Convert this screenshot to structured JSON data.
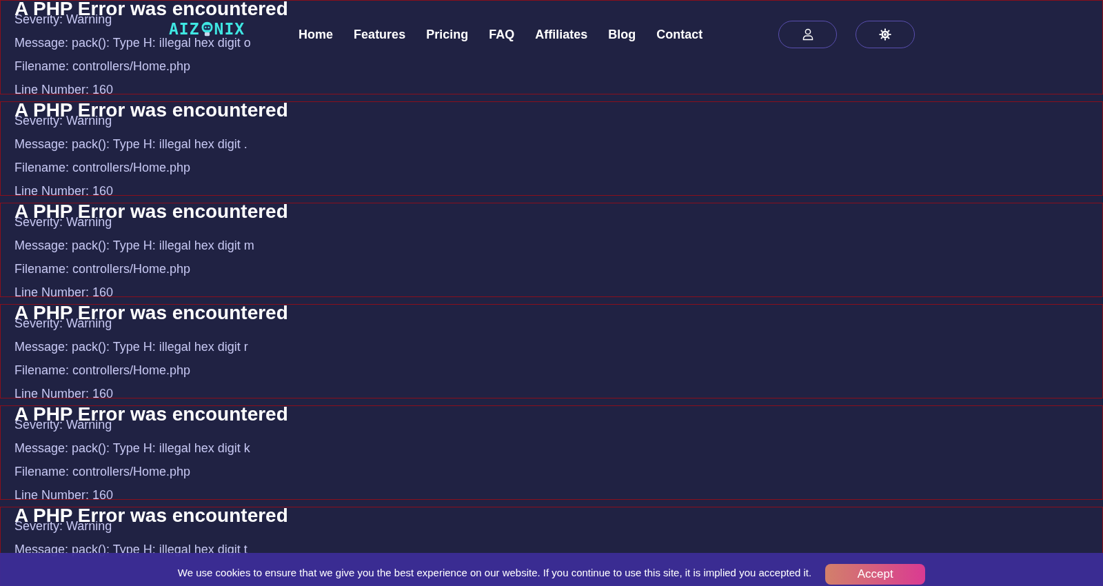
{
  "errors": [
    {
      "title": "A PHP Error was encountered",
      "lines": [
        "Severity: Warning",
        "Message: pack(): Type H: illegal hex digit o",
        "Filename: controllers/Home.php",
        "Line Number: 160"
      ]
    },
    {
      "title": "A PHP Error was encountered",
      "lines": [
        "Severity: Warning",
        "Message: pack(): Type H: illegal hex digit .",
        "Filename: controllers/Home.php",
        "Line Number: 160"
      ]
    },
    {
      "title": "A PHP Error was encountered",
      "lines": [
        "Severity: Warning",
        "Message: pack(): Type H: illegal hex digit m",
        "Filename: controllers/Home.php",
        "Line Number: 160"
      ]
    },
    {
      "title": "A PHP Error was encountered",
      "lines": [
        "Severity: Warning",
        "Message: pack(): Type H: illegal hex digit r",
        "Filename: controllers/Home.php",
        "Line Number: 160"
      ]
    },
    {
      "title": "A PHP Error was encountered",
      "lines": [
        "Severity: Warning",
        "Message: pack(): Type H: illegal hex digit k",
        "Filename: controllers/Home.php",
        "Line Number: 160"
      ]
    },
    {
      "title": "A PHP Error was encountered",
      "lines": [
        "Severity: Warning",
        "Message: pack(): Type H: illegal hex digit t"
      ]
    }
  ],
  "header": {
    "logo": {
      "left": "AIZ",
      "right": "NIX"
    },
    "nav": [
      "Home",
      "Features",
      "Pricing",
      "FAQ",
      "Affiliates",
      "Blog",
      "Contact"
    ]
  },
  "cookie_bar": {
    "text": "We use cookies to ensure that we give you the best experience on our website. If you continue to use this site, it is implied you accepted it.",
    "button": "Accept"
  }
}
